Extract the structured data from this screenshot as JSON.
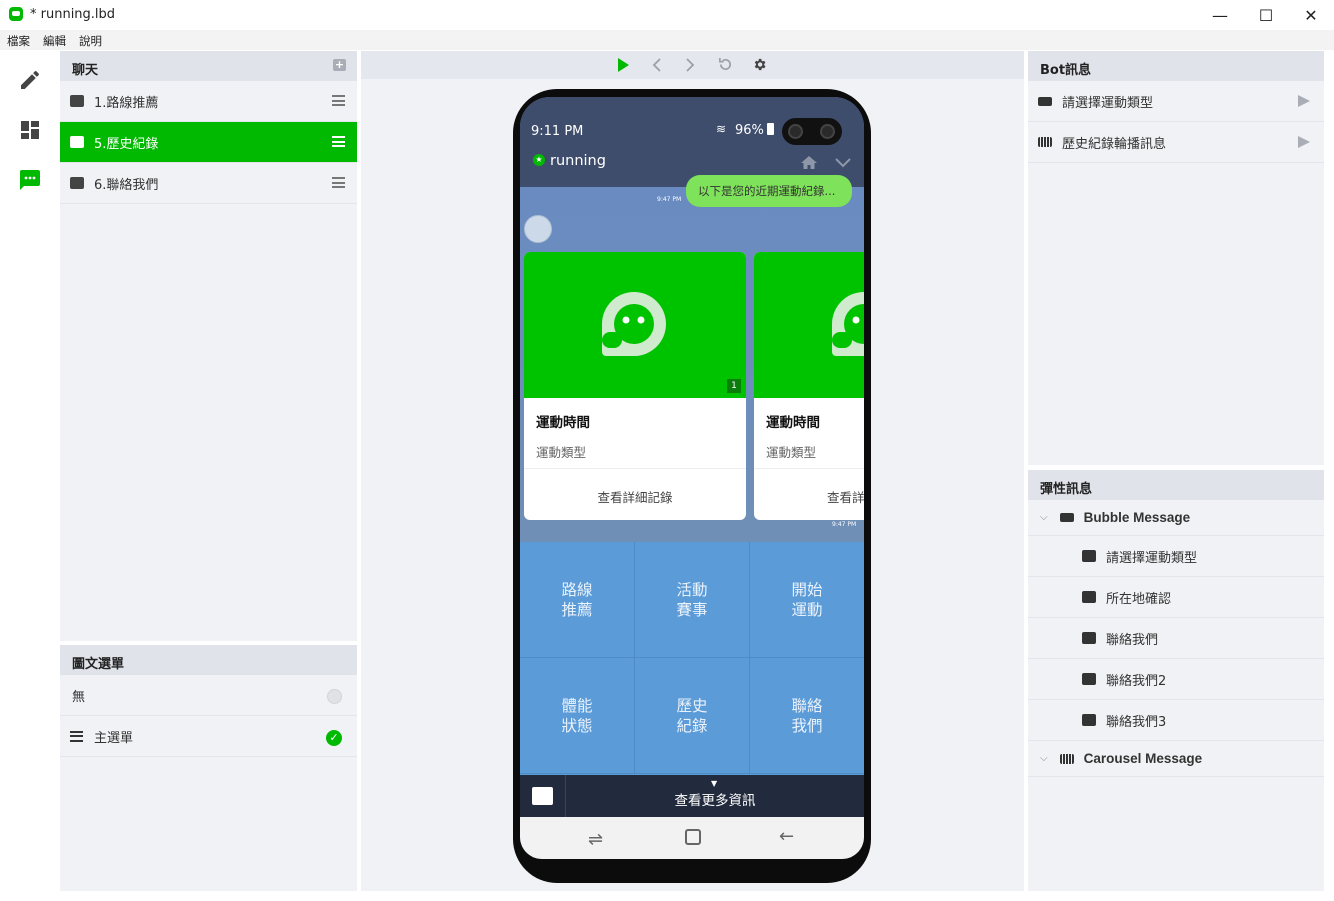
{
  "window": {
    "title": "* running.lbd"
  },
  "menu": [
    "檔案",
    "編輯",
    "說明"
  ],
  "chat_panel": {
    "title": "聊天",
    "items": [
      {
        "label": "1.路線推薦",
        "active": false
      },
      {
        "label": "5.歷史紀錄",
        "active": true
      },
      {
        "label": "6.聯絡我們",
        "active": false
      }
    ]
  },
  "richmenu_panel": {
    "title": "圖文選單",
    "items": [
      {
        "label": "無",
        "selected": false
      },
      {
        "label": "主選單",
        "selected": true
      }
    ]
  },
  "preview": {
    "status_time": "9:11 PM",
    "battery": "96%",
    "chat_name": "running",
    "sent_message": "以下是您的近期運動紀錄...",
    "time_a": "9:47 PM",
    "time_b": "9:47 PM",
    "cards": [
      {
        "badge": "1",
        "title": "運動時間",
        "subtitle": "運動類型",
        "action": "查看詳細記錄"
      },
      {
        "badge": "",
        "title": "運動時間",
        "subtitle": "運動類型",
        "action": "查看詳細記錄"
      }
    ],
    "richmenu": [
      {
        "label_l1": "路線",
        "label_l2": "推薦"
      },
      {
        "label_l1": "活動",
        "label_l2": "賽事"
      },
      {
        "label_l1": "開始",
        "label_l2": "運動"
      },
      {
        "label_l1": "體能",
        "label_l2": "狀態"
      },
      {
        "label_l1": "歷史",
        "label_l2": "紀錄"
      },
      {
        "label_l1": "聯絡",
        "label_l2": "我們"
      }
    ],
    "bottom_bar": "查看更多資訊"
  },
  "bot_panel": {
    "title": "Bot訊息",
    "items": [
      {
        "label": "請選擇運動類型"
      },
      {
        "label": "歷史紀錄輪播訊息"
      }
    ]
  },
  "flex_panel": {
    "title": "彈性訊息",
    "groups": [
      {
        "label": "Bubble Message",
        "children": [
          "請選擇運動類型",
          "所在地確認",
          "聯絡我們",
          "聯絡我們2",
          "聯絡我們3"
        ]
      },
      {
        "label": "Carousel Message",
        "children": []
      }
    ]
  },
  "colors": {
    "accent": "#00b900",
    "header": "#3f4d6c",
    "richmenu": "#5b9bd8"
  }
}
